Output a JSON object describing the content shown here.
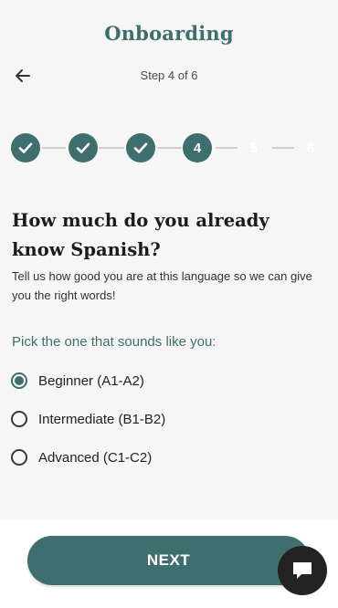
{
  "header": {
    "title": "Onboarding",
    "step_label": "Step 4 of 6"
  },
  "stepper": {
    "steps": [
      {
        "label": "",
        "state": "done"
      },
      {
        "label": "",
        "state": "done"
      },
      {
        "label": "",
        "state": "done"
      },
      {
        "label": "4",
        "state": "current"
      },
      {
        "label": "5",
        "state": "pending"
      },
      {
        "label": "6",
        "state": "pending"
      }
    ]
  },
  "question": {
    "title": "How much do you already know Spanish?",
    "subtitle": "Tell us how good you are at this language so we can give you the right words!"
  },
  "choices": {
    "prompt": "Pick the one that sounds like you:",
    "options": [
      {
        "label": "Beginner (A1-A2)",
        "selected": true
      },
      {
        "label": "Intermediate (B1-B2)",
        "selected": false
      },
      {
        "label": "Advanced (C1-C2)",
        "selected": false
      }
    ]
  },
  "footer": {
    "next_label": "NEXT"
  },
  "colors": {
    "accent": "#3f6e6e",
    "background": "#f6f6f6",
    "chat_button": "#232323"
  },
  "icons": {
    "back": "arrow-left-icon",
    "done_step": "check-icon",
    "chat": "chat-bubble-icon"
  }
}
